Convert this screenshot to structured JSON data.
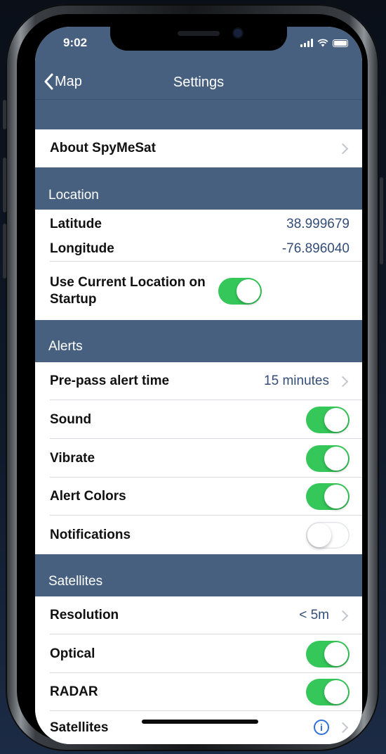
{
  "status": {
    "time": "9:02"
  },
  "nav": {
    "back_label": "Map",
    "title": "Settings"
  },
  "about": {
    "label": "About SpyMeSat"
  },
  "location": {
    "header": "Location",
    "latitude_label": "Latitude",
    "latitude_value": "38.999679",
    "longitude_label": "Longitude",
    "longitude_value": "-76.896040",
    "use_current_label": "Use Current Location on Startup",
    "use_current_on": true
  },
  "alerts": {
    "header": "Alerts",
    "prepass_label": "Pre-pass alert time",
    "prepass_value": "15 minutes",
    "sound_label": "Sound",
    "sound_on": true,
    "vibrate_label": "Vibrate",
    "vibrate_on": true,
    "colors_label": "Alert Colors",
    "colors_on": true,
    "notifications_label": "Notifications",
    "notifications_on": false
  },
  "satellites": {
    "header": "Satellites",
    "resolution_label": "Resolution",
    "resolution_value": "< 5m",
    "optical_label": "Optical",
    "optical_on": true,
    "radar_label": "RADAR",
    "radar_on": true,
    "satellites_label": "Satellites"
  },
  "colors": {
    "header_bg": "#47607f",
    "toggle_on": "#35c759",
    "value_text": "#324d78",
    "info_blue": "#2f6fde"
  },
  "icons": [
    "back-chevron-icon",
    "chevron-right-icon",
    "signal-icon",
    "wifi-icon",
    "battery-icon",
    "info-icon"
  ]
}
